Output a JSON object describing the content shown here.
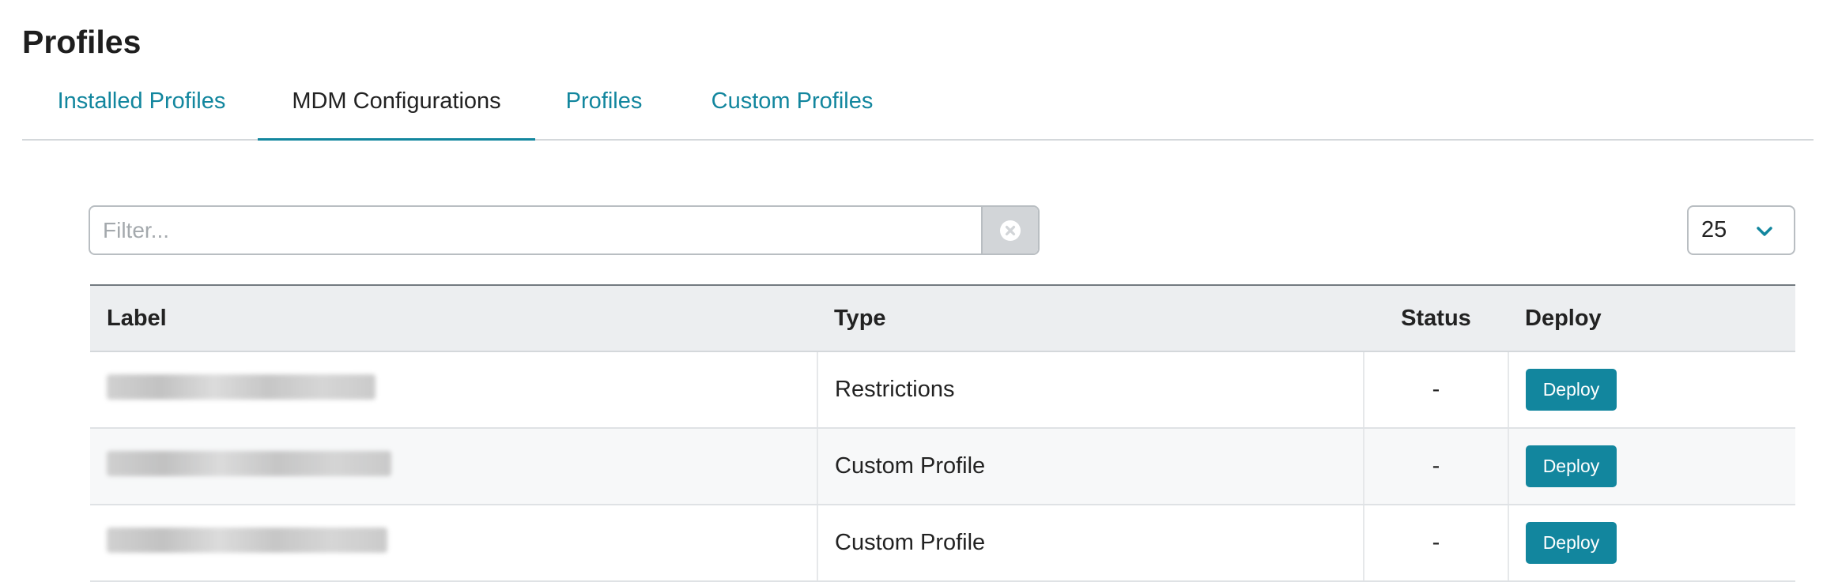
{
  "page": {
    "title": "Profiles"
  },
  "tabs": [
    {
      "label": "Installed Profiles",
      "active": false
    },
    {
      "label": "MDM Configurations",
      "active": true
    },
    {
      "label": "Profiles",
      "active": false
    },
    {
      "label": "Custom Profiles",
      "active": false
    }
  ],
  "filter": {
    "placeholder": "Filter...",
    "value": ""
  },
  "page_size": {
    "value": "25"
  },
  "table": {
    "headers": {
      "label": "Label",
      "type": "Type",
      "status": "Status",
      "deploy": "Deploy"
    },
    "rows": [
      {
        "label": "",
        "type": "Restrictions",
        "status": "-",
        "deploy": "Deploy"
      },
      {
        "label": "",
        "type": "Custom Profile",
        "status": "-",
        "deploy": "Deploy"
      },
      {
        "label": "",
        "type": "Custom Profile",
        "status": "-",
        "deploy": "Deploy"
      }
    ]
  },
  "colors": {
    "accent": "#12869e",
    "header_bg": "#eceef0",
    "clear_bg": "#d2d5d8"
  },
  "icons": {
    "clear": "close-circle-icon",
    "dropdown": "chevron-down-icon"
  }
}
